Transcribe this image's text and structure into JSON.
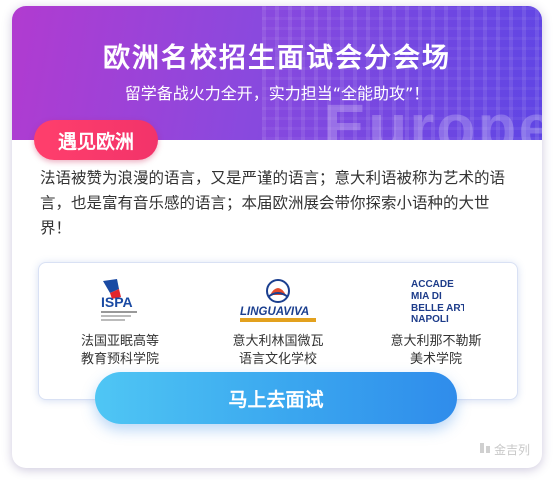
{
  "banner": {
    "title": "欧洲名校招生面试会分会场",
    "subtitle": "留学备战火力全开，实力担当“全能助攻”！",
    "background_word": "Europe"
  },
  "tag": {
    "label": "遇见欧洲"
  },
  "description": "法语被赞为浪漫的语言，又是严谨的语言；意大利语被称为艺术的语言，也是富有音乐感的语言；本届欧洲展会带你探索小语种的大世界！",
  "schools": [
    {
      "name_line1": "法国亚眠高等",
      "name_line2": "教育预科学院",
      "logo": "ispa-logo",
      "logo_text": "ISPA"
    },
    {
      "name_line1": "意大利林国微瓦",
      "name_line2": "语言文化学校",
      "logo": "linguaviva-logo",
      "logo_text": "LINGUAVIVA"
    },
    {
      "name_line1": "意大利那不勒斯",
      "name_line2": "美术学院",
      "logo": "accademia-napoli-logo",
      "logo_text": "ACCADEMIA DI BELLE ARTI NAPOLI"
    }
  ],
  "cta": {
    "label": "马上去面试"
  },
  "watermark": {
    "text": "金吉列"
  },
  "colors": {
    "banner_start": "#b13bd0",
    "banner_end": "#5f45e4",
    "tag": "#f2336a",
    "cta": "#3aa6ef"
  }
}
